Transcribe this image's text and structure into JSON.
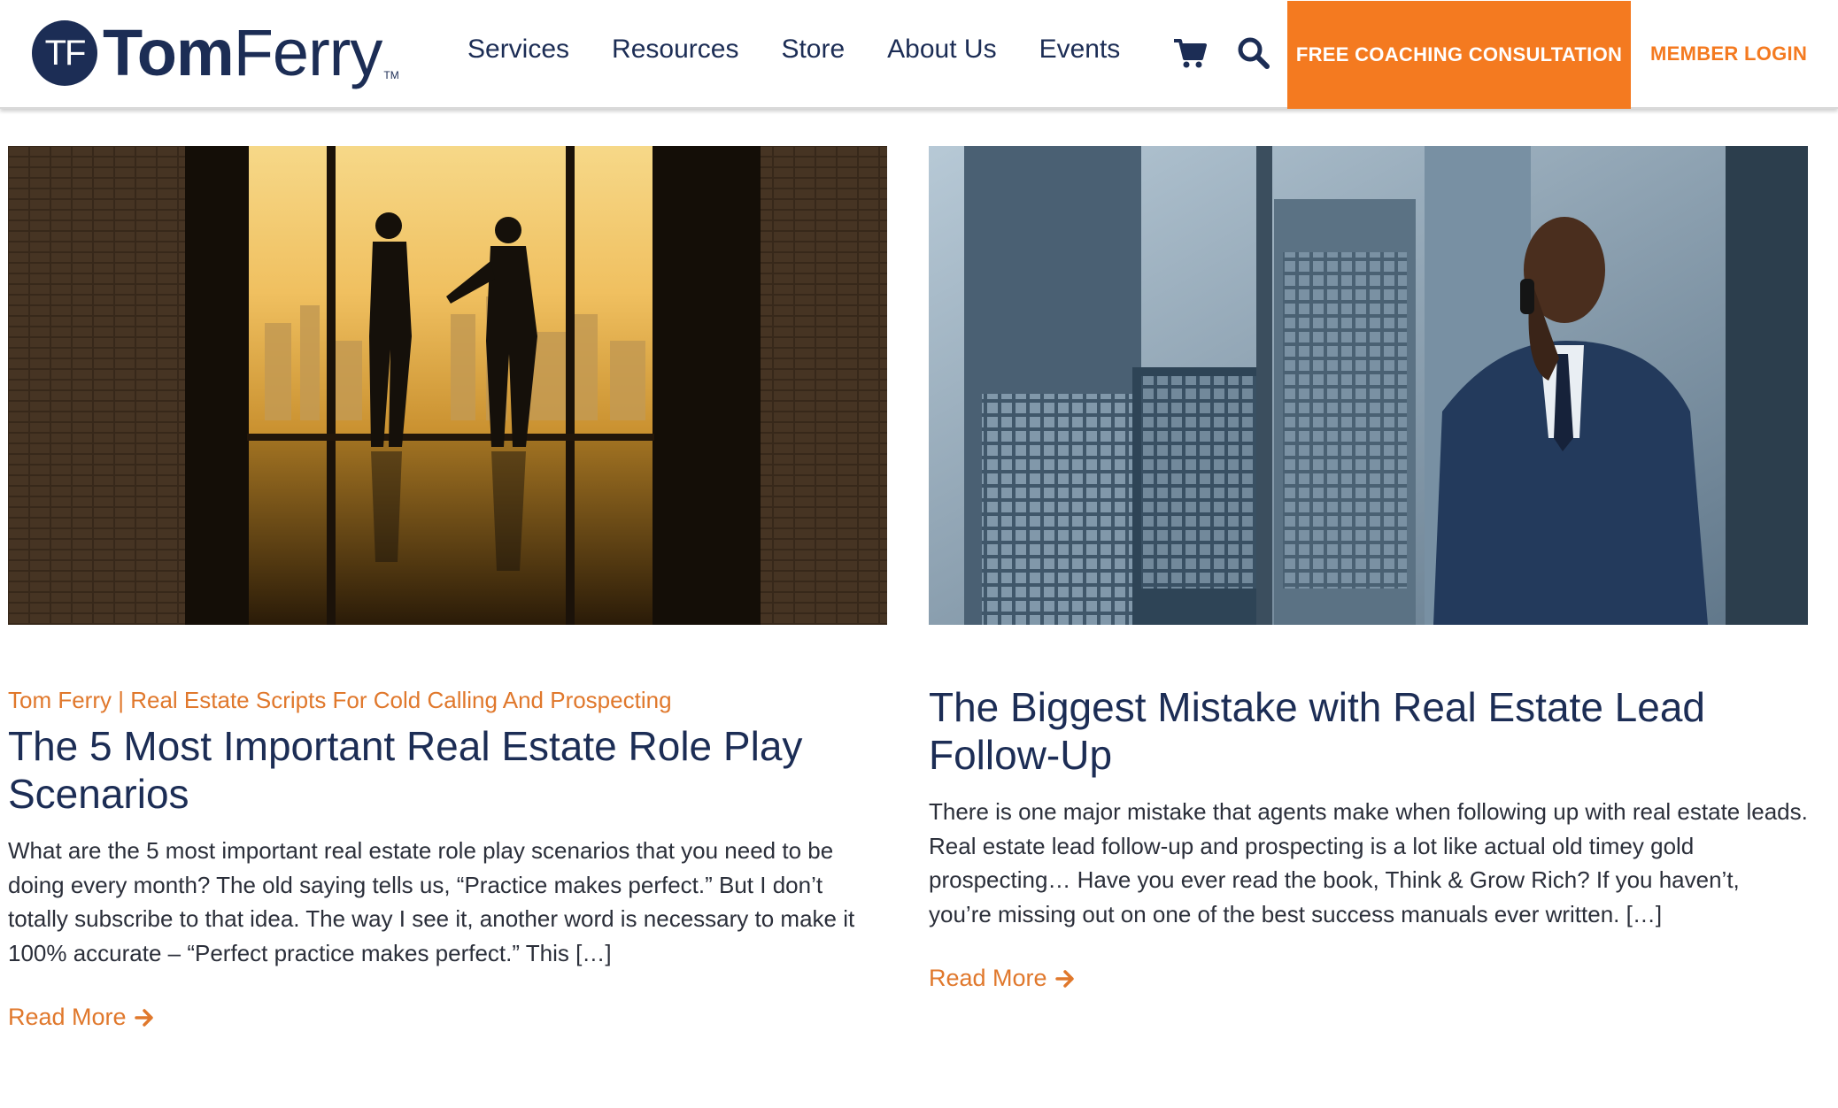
{
  "brand": {
    "monogram": "TF",
    "name_first": "Tom",
    "name_second": "Ferry",
    "trademark": "TM",
    "navy": "#1c2d55",
    "orange": "#f47a20"
  },
  "nav": {
    "items": [
      {
        "label": "Services"
      },
      {
        "label": "Resources"
      },
      {
        "label": "Store"
      },
      {
        "label": "About Us"
      },
      {
        "label": "Events"
      }
    ],
    "cart_icon": "shopping-cart-icon",
    "search_icon": "search-icon",
    "cta_label": "FREE COACHING CONSULTATION",
    "login_label": "MEMBER LOGIN"
  },
  "posts": [
    {
      "image": "two-businessmen-silhouette-city-window",
      "author": "Tom Ferry",
      "separator": "|",
      "category": "Real Estate Scripts For Cold Calling And Prospecting",
      "title": "The 5 Most Important Real Estate Role Play Scenarios",
      "excerpt": "What are the 5 most important real estate role play scenarios that you need to be doing every month? The old saying tells us, “Practice makes perfect.” But I don’t totally subscribe to that idea. The way I see it, another word is necessary to make it 100% accurate – “Perfect practice makes perfect.” This […]",
      "read_more": "Read More"
    },
    {
      "image": "businessman-on-phone-skyscrapers",
      "title": "The Biggest Mistake with Real Estate Lead Follow-Up",
      "excerpt": "There is one major mistake that agents make when following up with real estate leads. Real estate lead follow-up and prospecting is a lot like actual old timey gold prospecting… Have you ever read the book, Think & Grow Rich? If you haven’t, you’re missing out on one of the best success manuals ever written. […]",
      "read_more": "Read More"
    }
  ]
}
